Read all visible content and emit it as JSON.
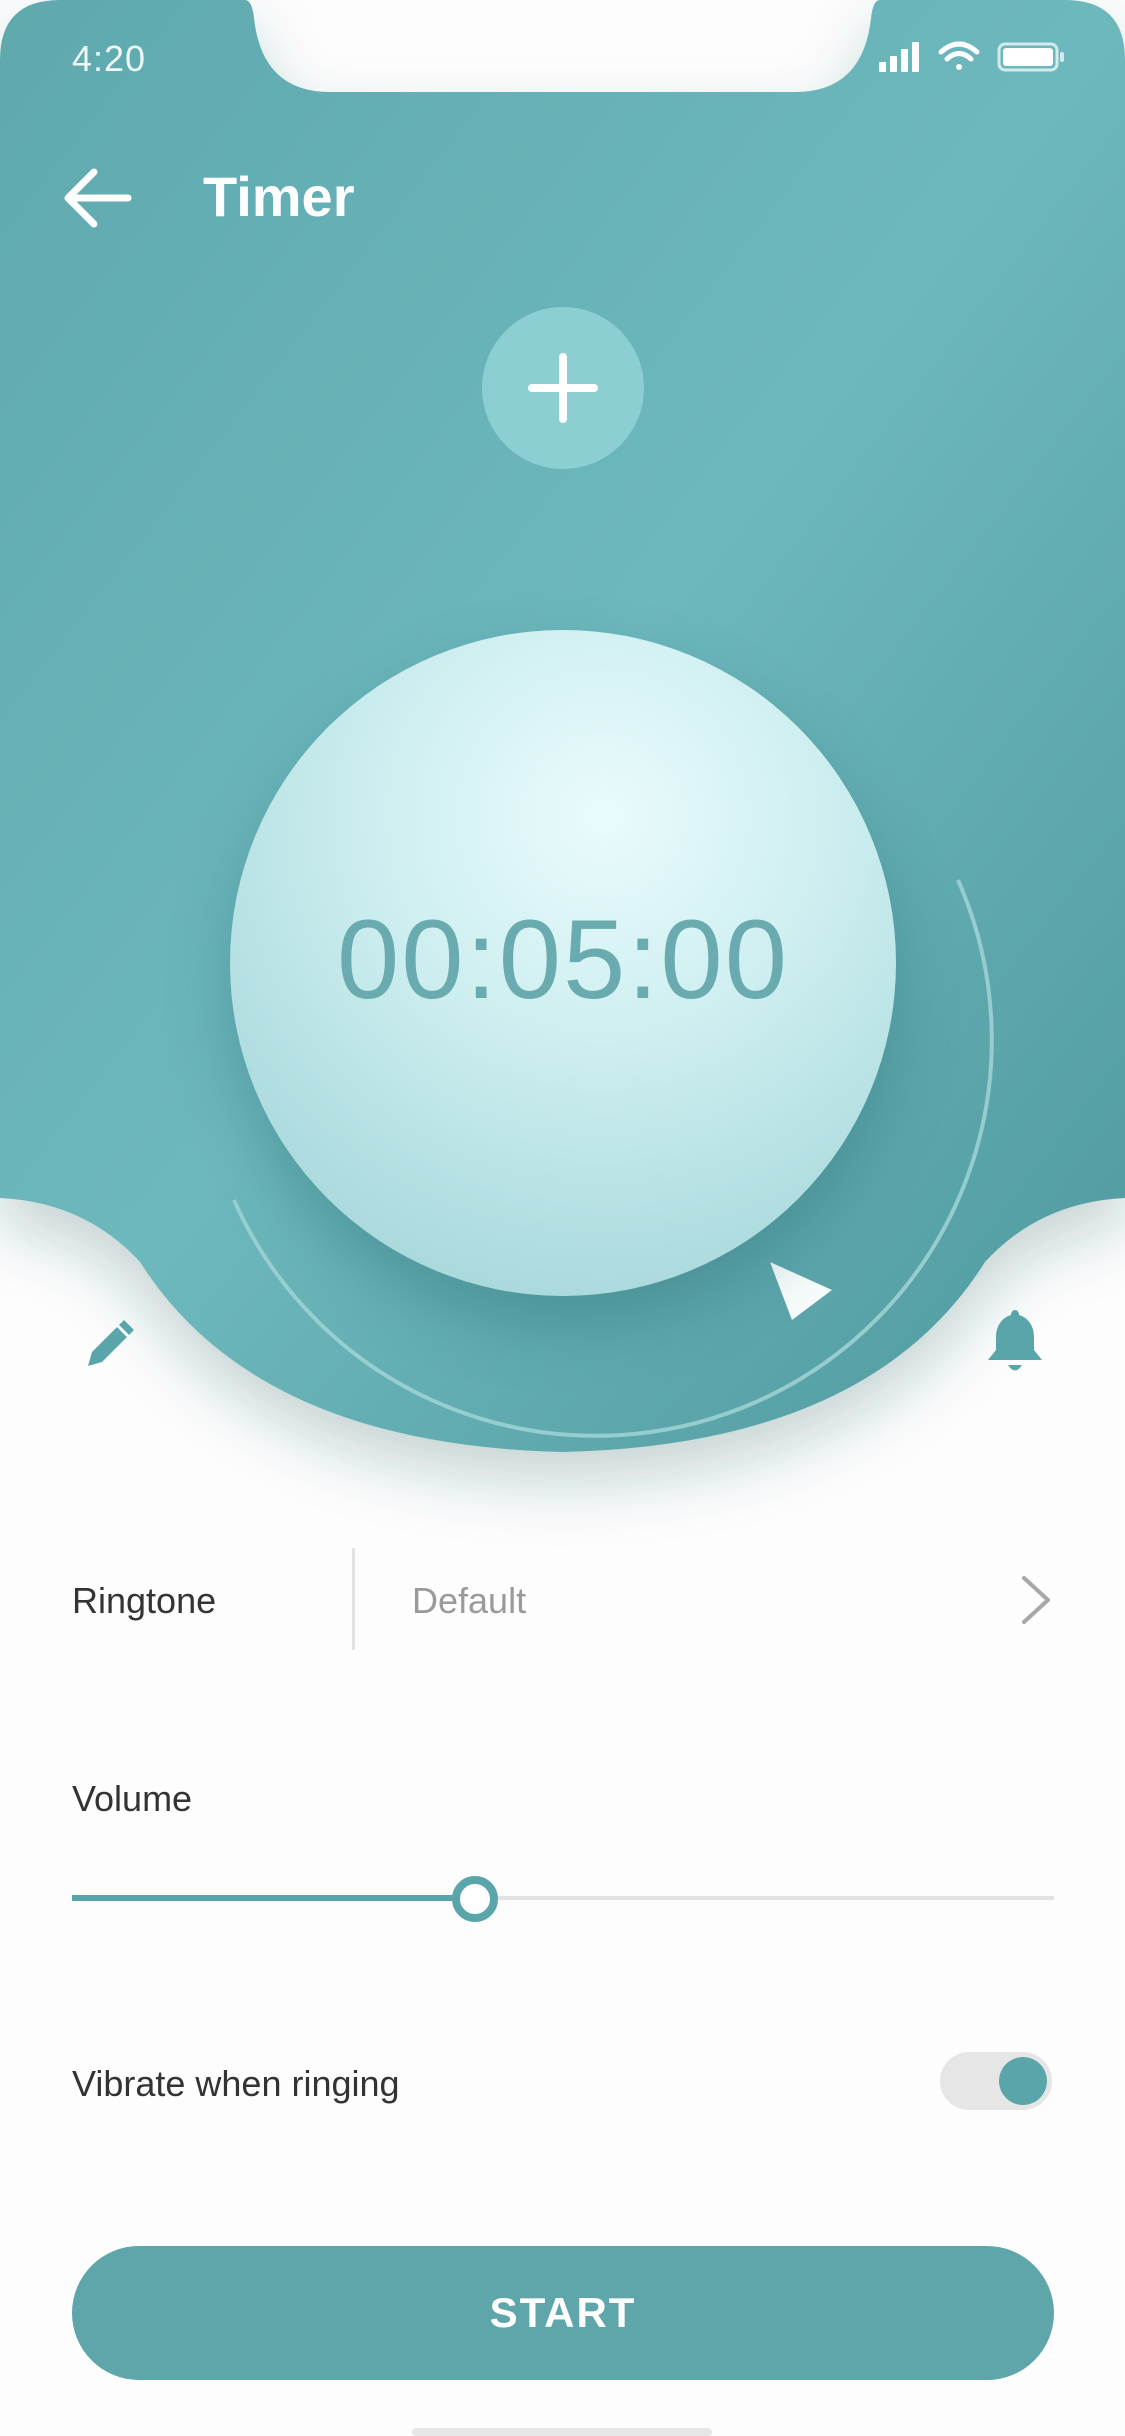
{
  "status_bar": {
    "time": "4:20"
  },
  "header": {
    "title": "Timer"
  },
  "timer": {
    "display": "00:05:00"
  },
  "ringtone": {
    "label": "Ringtone",
    "value": "Default"
  },
  "volume": {
    "label": "Volume",
    "level": 0.41
  },
  "vibrate": {
    "label": "Vibrate when ringing",
    "enabled": true
  },
  "start_button": {
    "label": "START"
  },
  "icons": {
    "back": "arrow-left-icon",
    "add": "plus-icon",
    "edit": "pencil-icon",
    "alarm": "bell-icon",
    "ringtone_more": "chevron-right-icon",
    "signal": "signal-icon",
    "wifi": "wifi-icon",
    "battery": "battery-icon"
  },
  "colors": {
    "accent": "#5fa6aa",
    "header_light": "#6db8bd",
    "header_dark": "#4f9a9f",
    "knob": "#cdeef0",
    "timer_text": "#6aabb0"
  }
}
